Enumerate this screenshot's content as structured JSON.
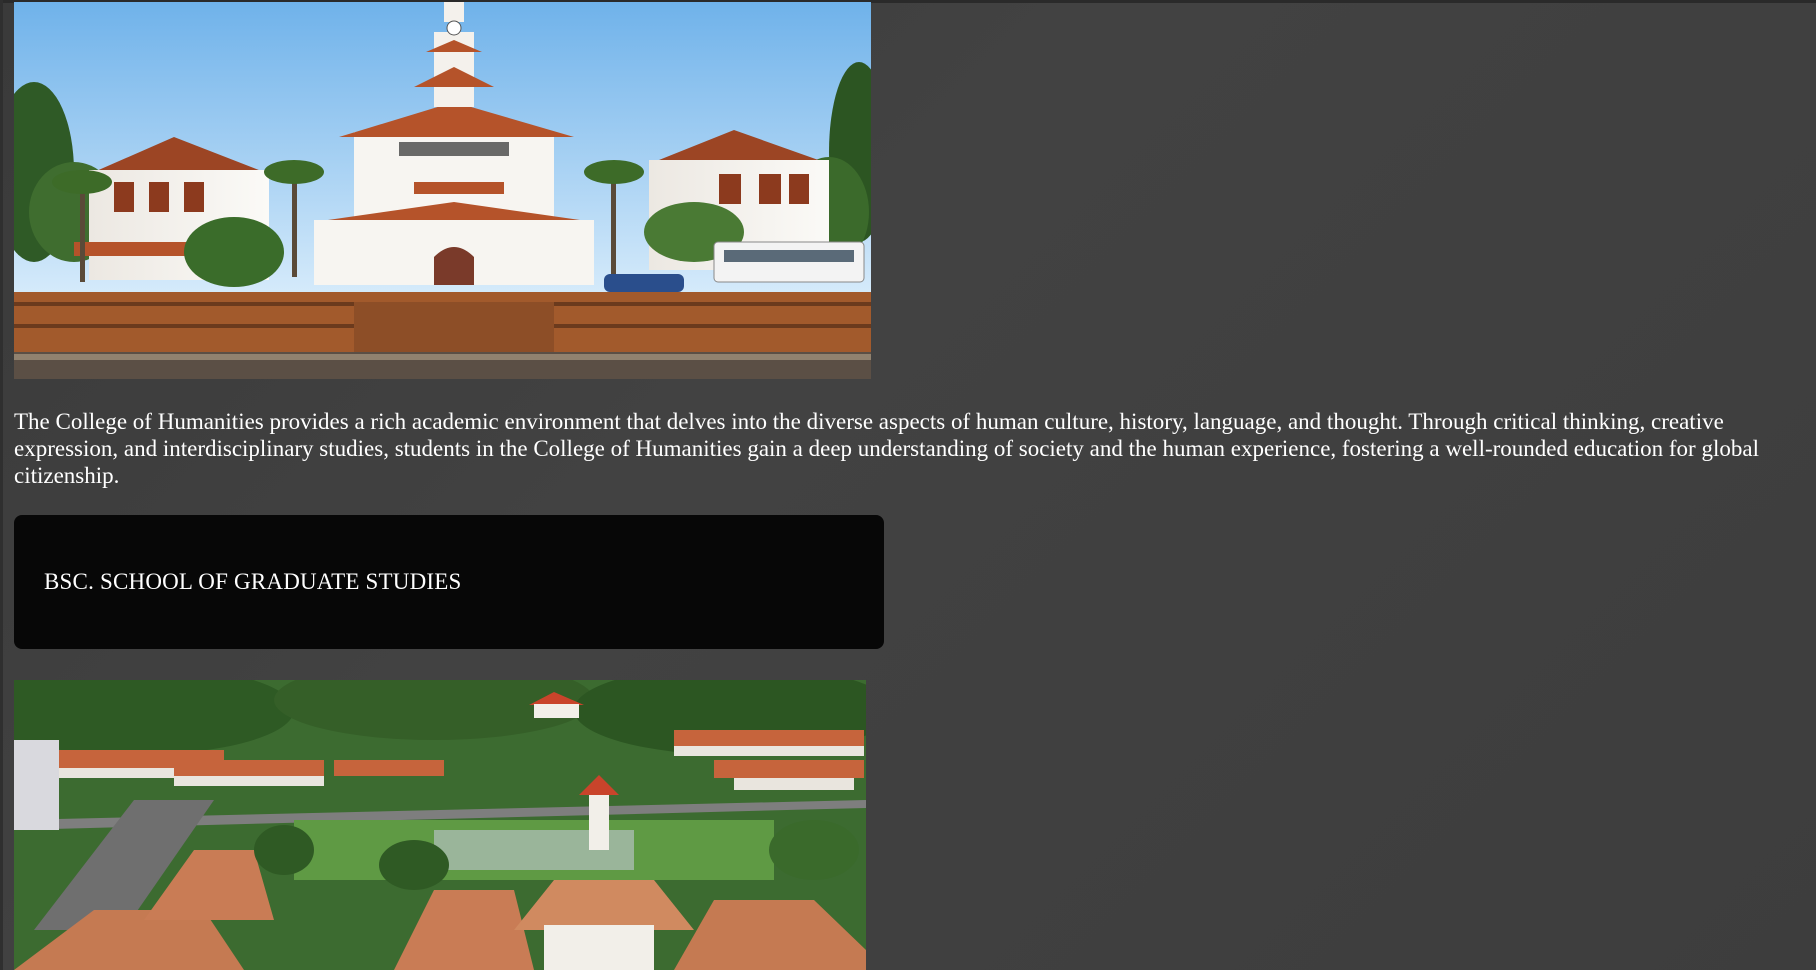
{
  "images": {
    "humanities_photo": {
      "alt": "College of Humanities building"
    },
    "aerial_photo": {
      "alt": "Aerial view of campus"
    }
  },
  "content": {
    "description": "The College of Humanities provides a rich academic environment that delves into the diverse aspects of human culture, history, language, and thought. Through critical thinking, creative expression, and interdisciplinary studies, students in the College of Humanities gain a deep understanding of society and the human experience, fostering a well-rounded education for global citizenship."
  },
  "program_card": {
    "label": "BSC. SCHOOL OF GRADUATE STUDIES"
  },
  "colors": {
    "background": "#3f3f3f",
    "card_background": "#070707",
    "text": "#ffffff",
    "roof": "#b5532a",
    "wall": "#f4f1ec",
    "sky": "#8ec4f0"
  }
}
